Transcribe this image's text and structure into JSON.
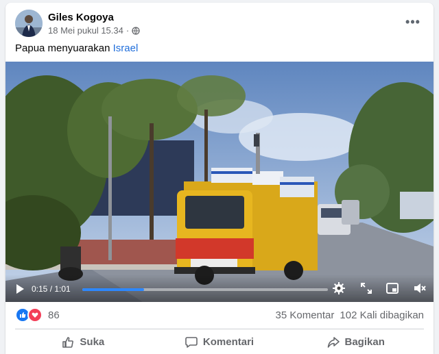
{
  "post": {
    "author": "Giles Kogoya",
    "timestamp": "18 Mei pukul 15.34",
    "privacy_icon": "globe-icon",
    "text_prefix": "Papua menyuarakan ",
    "text_tag": "Israel"
  },
  "video": {
    "current_time": "0:15",
    "separator": " / ",
    "duration": "1:01",
    "progress": 0.25,
    "icons": [
      "play-icon",
      "settings-gear-icon",
      "expand-icon",
      "picture-in-picture-icon",
      "mute-icon"
    ]
  },
  "stats": {
    "reaction_count": "86",
    "comments": "35 Komentar",
    "shares": "102 Kali dibagikan",
    "reaction_icons": [
      "like-reaction-icon",
      "love-reaction-icon"
    ]
  },
  "actions": {
    "like": "Suka",
    "comment": "Komentari",
    "share": "Bagikan"
  },
  "colors": {
    "link": "#216fdb",
    "progress": "#2d88ff",
    "like": "#1877f2",
    "love": "#f33e58"
  }
}
